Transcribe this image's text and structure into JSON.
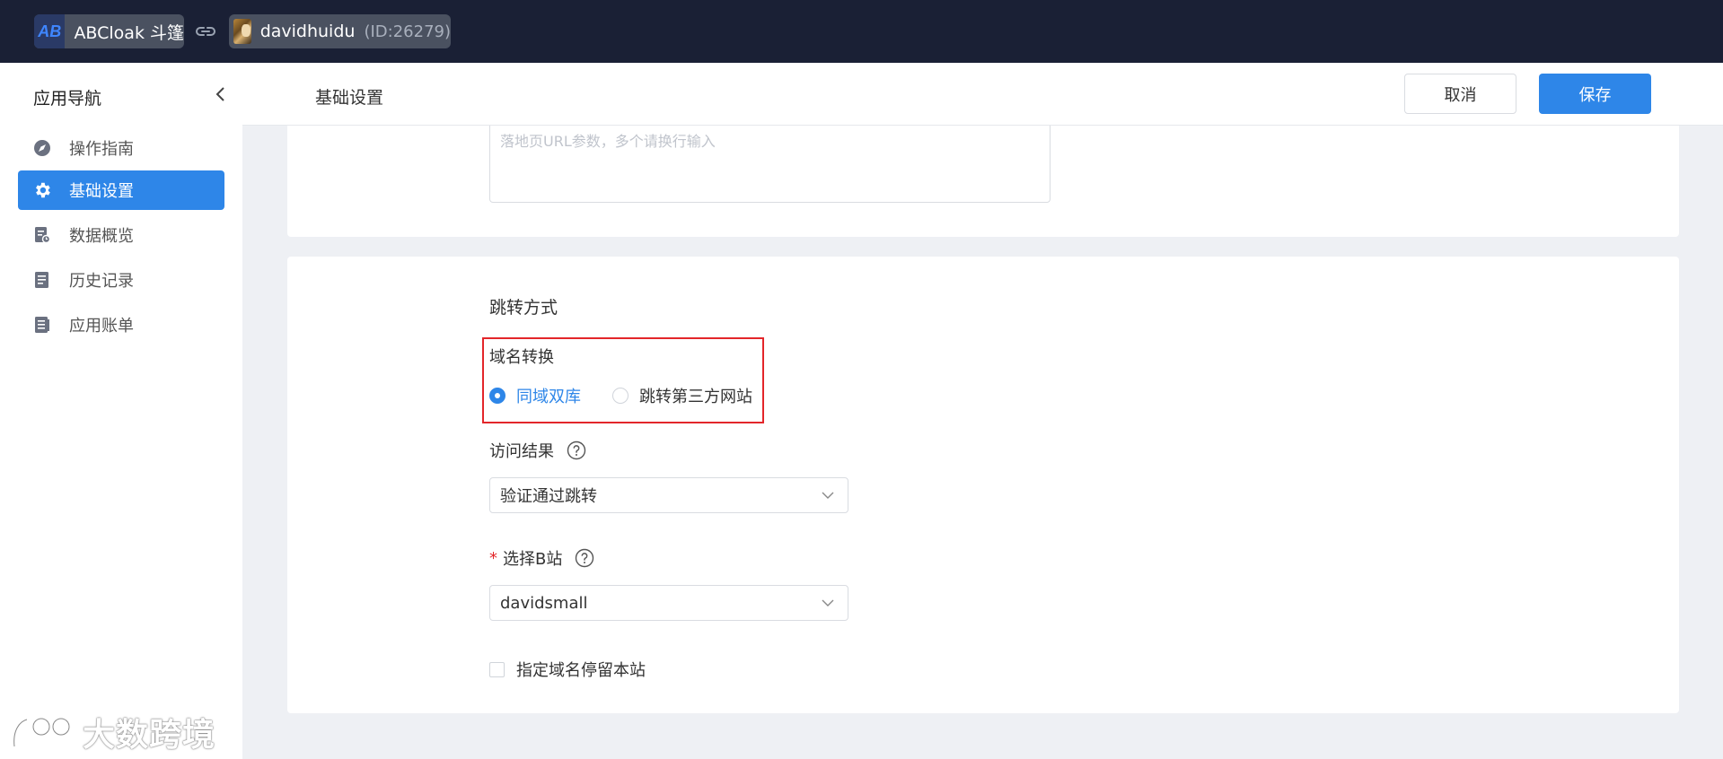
{
  "topbar": {
    "app_logo": "AB",
    "app_name": "ABCloak 斗篷",
    "user_name": "davidhuidu",
    "user_id": "(ID:26279)"
  },
  "sidebar": {
    "title": "应用导航",
    "items": [
      {
        "label": "操作指南",
        "icon": "compass-icon",
        "active": false
      },
      {
        "label": "基础设置",
        "icon": "gear-icon",
        "active": true
      },
      {
        "label": "数据概览",
        "icon": "report-icon",
        "active": false
      },
      {
        "label": "历史记录",
        "icon": "document-icon",
        "active": false
      },
      {
        "label": "应用账单",
        "icon": "bill-icon",
        "active": false
      }
    ]
  },
  "header": {
    "title": "基础设置",
    "cancel_label": "取消",
    "save_label": "保存"
  },
  "params": {
    "placeholder": "落地页URL参数，多个请换行输入"
  },
  "redirect": {
    "section_title": "跳转方式",
    "domain_label": "域名转换",
    "options": [
      "同域双库",
      "跳转第三方网站"
    ],
    "selected_option": "同域双库",
    "result_label": "访问结果",
    "result_value": "验证通过跳转",
    "site_required_mark": "*",
    "site_label": "选择B站",
    "site_value": "davidsmall",
    "stay_label": "指定域名停留本站",
    "stay_checked": false
  },
  "watermark": {
    "text": "大数跨境"
  },
  "colors": {
    "accent": "#2e86e8",
    "topbar": "#1a2035",
    "highlight": "#e3262a"
  }
}
